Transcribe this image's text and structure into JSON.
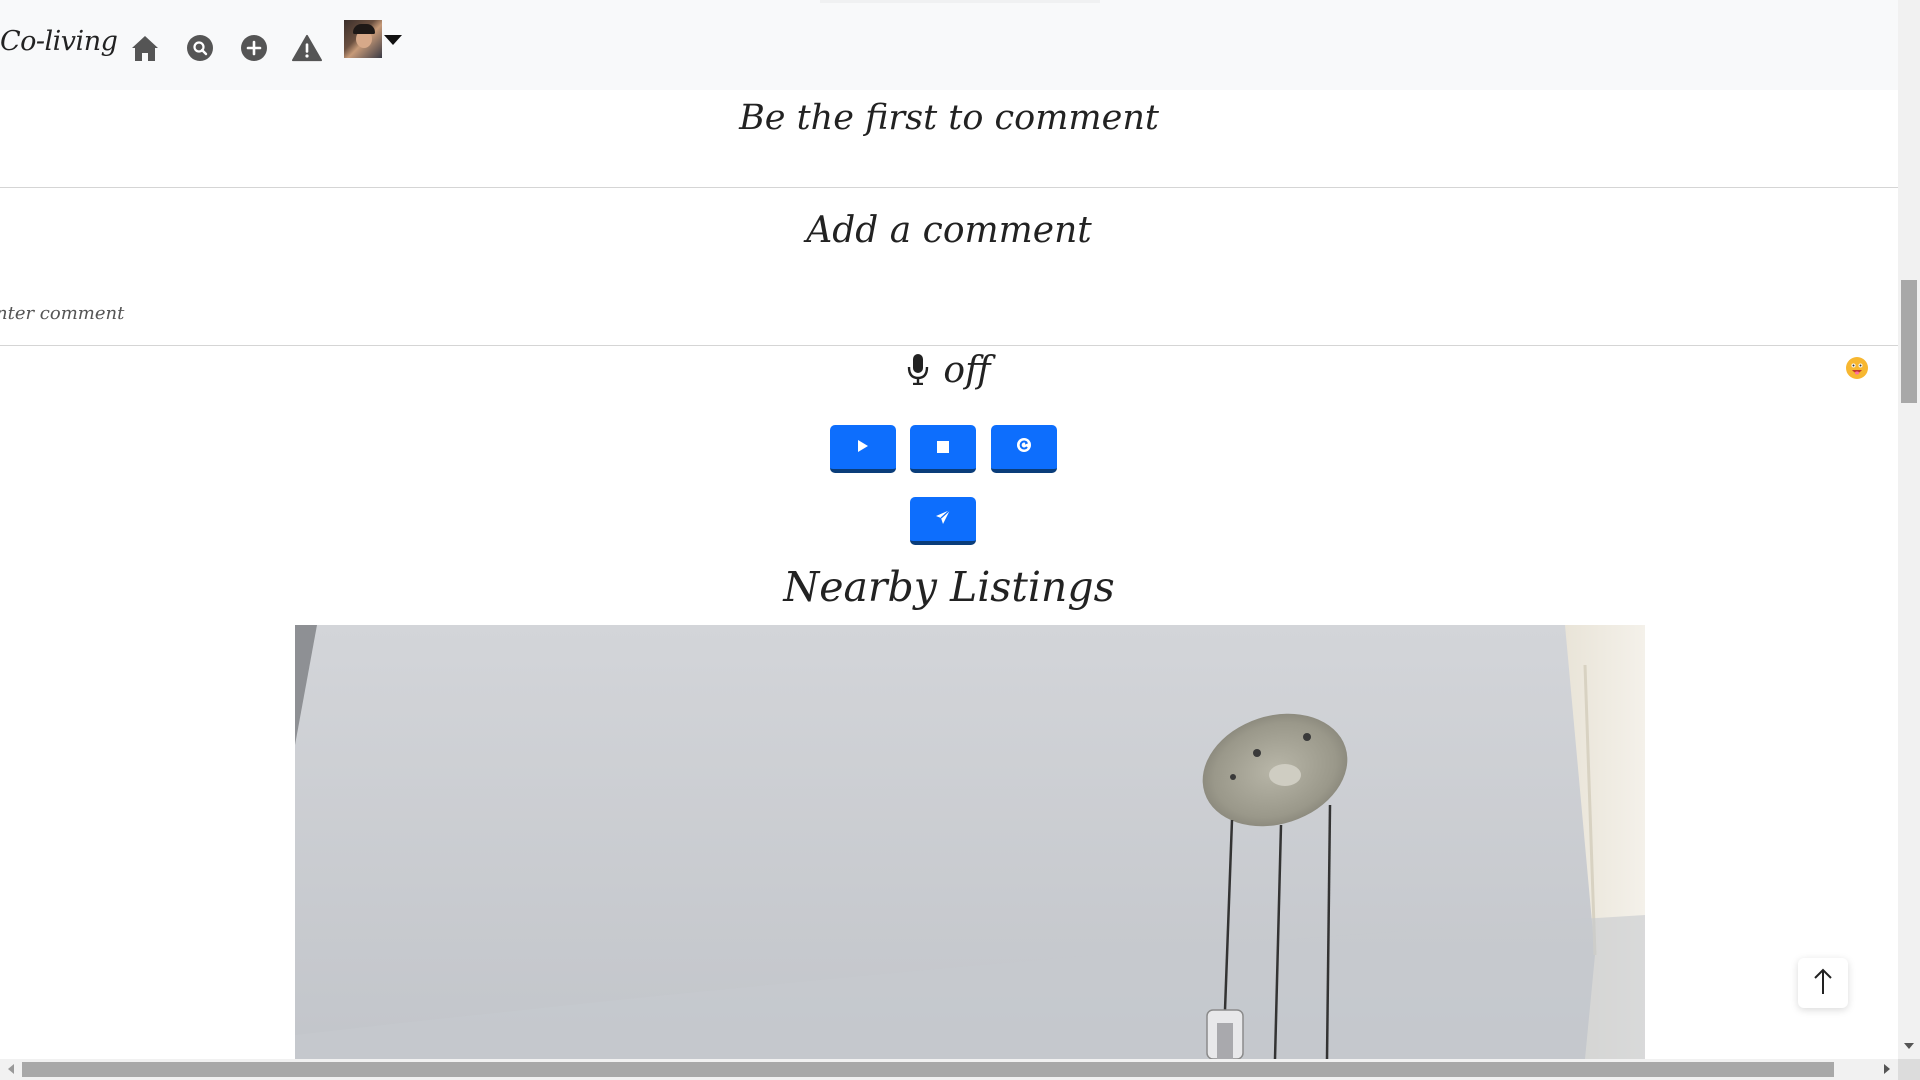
{
  "navbar": {
    "brand": "Co-living",
    "icons": [
      "home-icon",
      "search-icon",
      "add-icon",
      "warning-icon"
    ],
    "avatar": "user-avatar",
    "dropdown": "caret-down-icon"
  },
  "comments": {
    "empty_message": "Be the first to comment",
    "add_heading": "Add a comment",
    "input_value": "nter comment",
    "mic_status": "off"
  },
  "controls": {
    "buttons": [
      "play-icon",
      "stop-icon",
      "reset-icon",
      "send-icon"
    ]
  },
  "nearby": {
    "heading": "Nearby Listings"
  },
  "colors": {
    "primary": "#0d6efd",
    "button_border": "#0a3d7a",
    "navbar_bg": "#f8f9fa",
    "text": "#222222"
  }
}
